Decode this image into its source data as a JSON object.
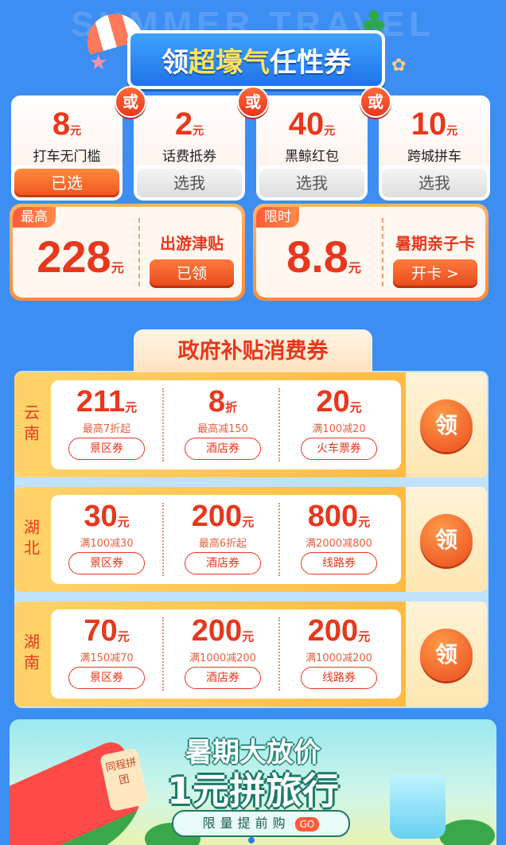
{
  "header": {
    "watermark": "SUMMER TRAVEL SEASON",
    "title_a": "领",
    "title_b": "超壕气",
    "title_c": "任性券"
  },
  "choice_cards": [
    {
      "value": "8",
      "unit": "元",
      "label": "打车无门槛",
      "button": "已选",
      "selected": true
    },
    {
      "value": "2",
      "unit": "元",
      "label": "话费抵券",
      "button": "选我",
      "selected": false
    },
    {
      "value": "40",
      "unit": "元",
      "label": "黑鲸红包",
      "button": "选我",
      "selected": false
    },
    {
      "value": "10",
      "unit": "元",
      "label": "跨城拼车",
      "button": "选我",
      "selected": false
    }
  ],
  "or_label": "或",
  "promos": [
    {
      "tag": "最高",
      "amount": "228",
      "unit": "元",
      "name": "出游津贴",
      "button": "已领"
    },
    {
      "tag": "限时",
      "amount": "8.8",
      "unit": "元",
      "name": "暑期亲子卡",
      "button": "开卡 >"
    }
  ],
  "gov": {
    "title": "政府补贴消费券",
    "claim_label": "领",
    "rows": [
      {
        "province": "云南",
        "coupons": [
          {
            "value": "211",
            "unit": "元",
            "sub": "最高7折起",
            "type": "景区券"
          },
          {
            "value": "8",
            "unit": "折",
            "sub": "最高减150",
            "type": "酒店券"
          },
          {
            "value": "20",
            "unit": "元",
            "sub": "满100减20",
            "type": "火车票券"
          }
        ]
      },
      {
        "province": "湖北",
        "coupons": [
          {
            "value": "30",
            "unit": "元",
            "sub": "满100减30",
            "type": "景区券"
          },
          {
            "value": "200",
            "unit": "元",
            "sub": "最高6折起",
            "type": "酒店券"
          },
          {
            "value": "800",
            "unit": "元",
            "sub": "满2000减800",
            "type": "线路券"
          }
        ]
      },
      {
        "province": "湖南",
        "coupons": [
          {
            "value": "70",
            "unit": "元",
            "sub": "满150减70",
            "type": "景区券"
          },
          {
            "value": "200",
            "unit": "元",
            "sub": "满1000减200",
            "type": "酒店券"
          },
          {
            "value": "200",
            "unit": "元",
            "sub": "满1000减200",
            "type": "线路券"
          }
        ]
      }
    ]
  },
  "banner": {
    "line1": "暑期大放价",
    "line2": "1元拼旅行",
    "cta": "限量提前购",
    "go": "GO",
    "badge": "同程拼团"
  },
  "colors": {
    "background": "#3d8ef3",
    "accent": "#e8371d",
    "gold": "#ffb63a"
  }
}
